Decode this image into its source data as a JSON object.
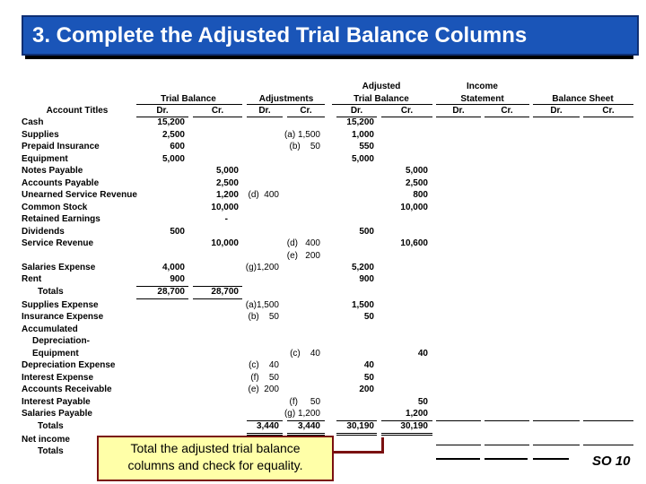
{
  "title": "3. Complete the Adjusted Trial Balance Columns",
  "headers": {
    "account_titles": "Account Titles",
    "trial_balance": "Trial Balance",
    "adjustments": "Adjustments",
    "adjusted_line1": "Adjusted",
    "adjusted_line2": "Trial Balance",
    "income_line1": "Income",
    "income_line2": "Statement",
    "balance_sheet": "Balance Sheet",
    "dr": "Dr.",
    "cr": "Cr."
  },
  "rows": [
    {
      "account": "Cash",
      "tb_dr": "15,200",
      "atb_dr": "15,200"
    },
    {
      "account": "Supplies",
      "tb_dr": "2,500",
      "adj_cr": "(a) 1,500",
      "atb_dr": "1,000"
    },
    {
      "account": "Prepaid Insurance",
      "tb_dr": "600",
      "adj_cr": "(b)    50",
      "atb_dr": "550"
    },
    {
      "account": "Equipment",
      "tb_dr": "5,000",
      "atb_dr": "5,000"
    },
    {
      "account": "Notes Payable",
      "tb_cr": "5,000",
      "atb_cr": "5,000"
    },
    {
      "account": "Accounts Payable",
      "tb_cr": "2,500",
      "atb_cr": "2,500"
    },
    {
      "account": "Unearned Service Revenue",
      "tb_cr": "1,200",
      "adj_dr": "(d)  400",
      "atb_cr": "800"
    },
    {
      "account": "Common Stock",
      "tb_cr": "10,000",
      "atb_cr": "10,000"
    },
    {
      "account": "Retained Earnings",
      "tb_cr": "-"
    },
    {
      "account": "Dividends",
      "tb_dr": "500",
      "atb_dr": "500"
    },
    {
      "account": "Service Revenue",
      "tb_cr": "10,000",
      "adj_cr": "(d)   400",
      "atb_cr": "10,600"
    },
    {
      "account": "",
      "adj_cr": "(e)   200"
    },
    {
      "account": "Salaries Expense",
      "tb_dr": "4,000",
      "adj_dr": "(g)1,200",
      "atb_dr": "5,200"
    },
    {
      "account": "Rent",
      "tb_dr": "900",
      "atb_dr": "900"
    },
    {
      "account": "Totals",
      "indent": true,
      "tb_dr": "28,700",
      "tb_cr": "28,700",
      "total": "tb"
    },
    {
      "account": "Supplies Expense",
      "adj_dr": "(a)1,500",
      "atb_dr": "1,500"
    },
    {
      "account": "Insurance Expense",
      "adj_dr": "(b)    50",
      "atb_dr": "50"
    },
    {
      "account": "Accumulated"
    },
    {
      "account": "Depreciation-",
      "indent": true
    },
    {
      "account": "Equipment",
      "indent": true,
      "adj_cr": "(c)    40",
      "atb_cr": "40"
    },
    {
      "account": "Depreciation Expense",
      "adj_dr": "(c)    40",
      "atb_dr": "40"
    },
    {
      "account": "Interest Expense",
      "adj_dr": "(f)    50",
      "atb_dr": "50"
    },
    {
      "account": "Accounts Receivable",
      "adj_dr": "(e)  200",
      "atb_dr": "200"
    },
    {
      "account": "Interest Payable",
      "adj_cr": "(f)     50",
      "atb_cr": "50"
    },
    {
      "account": "Salaries Payable",
      "adj_cr": "(g) 1,200",
      "atb_cr": "1,200"
    },
    {
      "account": "Totals",
      "indent": true,
      "adj_dr": "3,440",
      "adj_cr": "3,440",
      "atb_dr": "30,190",
      "atb_cr": "30,190",
      "total": "adj"
    },
    {
      "account": "Net income"
    },
    {
      "account": "Totals",
      "indent": true
    }
  ],
  "callout": {
    "line1": "Total the adjusted trial balance",
    "line2": "columns and check for equality."
  },
  "slide_number": "SO 10",
  "colors": {
    "title_bg": "#1a55b8",
    "callout_bg": "#ffffa8",
    "callout_border": "#7a1010"
  }
}
